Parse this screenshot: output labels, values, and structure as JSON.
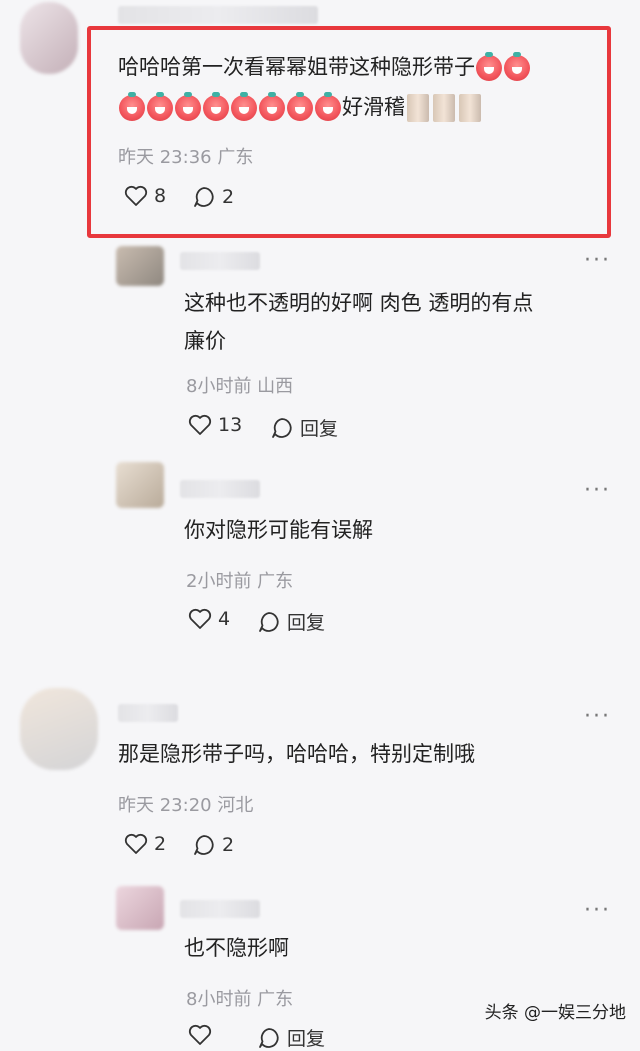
{
  "comments": [
    {
      "text_line1": "哈哈哈第一次看幂幂姐带这种隐形带子",
      "text_line2_suffix": "好滑稽",
      "time_location": "昨天 23:36 广东",
      "likes": "8",
      "replies": "2",
      "emoji_name": "laughing-tear-emoji",
      "mask_emoji_name": "face-mask-emoji"
    },
    {
      "text_line1": "这种也不透明的好啊 肉色 透明的有点",
      "text_line2": "廉价",
      "time_location": "8小时前 山西",
      "likes": "13",
      "reply_label": "回复"
    },
    {
      "text_line1": "你对隐形可能有误解",
      "time_location": "2小时前 广东",
      "likes": "4",
      "reply_label": "回复"
    },
    {
      "text_line1": "那是隐形带子吗，哈哈哈，特别定制哦",
      "time_location": "昨天 23:20 河北",
      "likes": "2",
      "replies": "2"
    },
    {
      "text_line1": "也不隐形啊",
      "time_location": "8小时前 广东",
      "reply_label": "回复"
    }
  ],
  "more_label": "···",
  "watermark": "头条 @一娱三分地",
  "highlight_color": "#e8383d"
}
